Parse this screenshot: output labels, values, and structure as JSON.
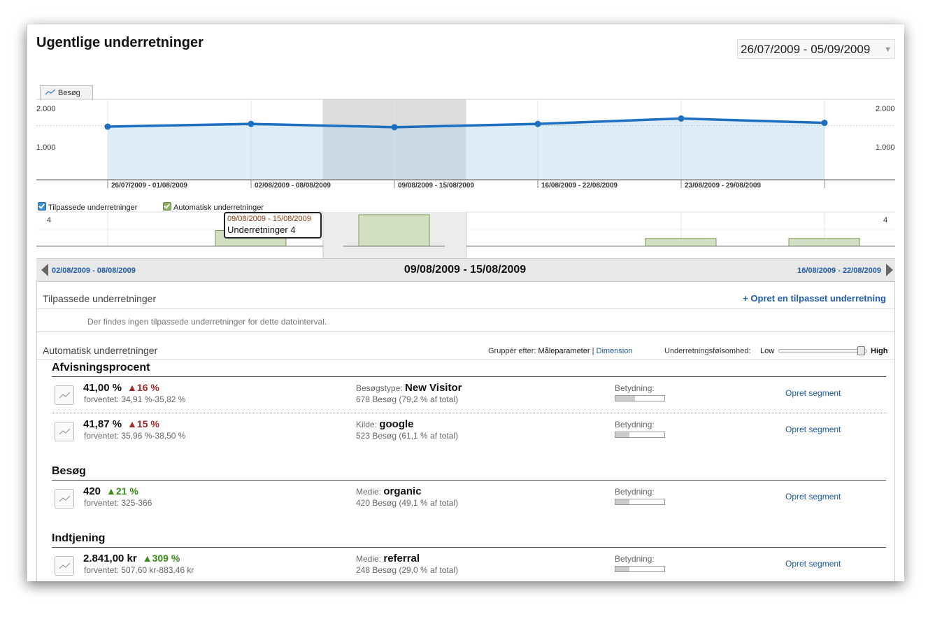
{
  "title": "Ugentlige underretninger",
  "date_range": "26/07/2009 - 05/09/2009",
  "chart_tab": "Besøg",
  "chart_data": {
    "type": "line",
    "series": [
      {
        "name": "Besøg",
        "values": [
          980,
          1030,
          970,
          1030,
          1130,
          1050
        ]
      }
    ],
    "ylim": [
      0,
      2000
    ],
    "y_ticks": [
      "2.000",
      "1.000"
    ],
    "x_labels": [
      "26/07/2009 - 01/08/2009",
      "02/08/2009 - 08/08/2009",
      "09/08/2009 - 15/08/2009",
      "16/08/2009 - 22/08/2009",
      "23/08/2009 - 29/08/2009"
    ],
    "highlighted_week": "09/08/2009 - 15/08/2009",
    "grid": true
  },
  "legend": {
    "custom": "Tilpassede underretninger",
    "auto": "Automatisk underretninger"
  },
  "alert_chart": {
    "y_max_label": "4",
    "values": [
      0,
      2,
      4,
      0,
      1,
      1
    ]
  },
  "tooltip": {
    "date": "09/08/2009 - 15/08/2009",
    "label": "Underretninger 4"
  },
  "nav": {
    "prev": "02/08/2009 - 08/08/2009",
    "current": "09/08/2009 - 15/08/2009",
    "next": "16/08/2009 - 22/08/2009"
  },
  "custom_section": {
    "heading": "Tilpassede underretninger",
    "create_link": "+ Opret en tilpasset underretning",
    "empty_text": "Der findes ingen tilpassede underretninger for dette datointerval."
  },
  "auto_section": {
    "heading": "Automatisk underretninger",
    "group_label": "Gruppér efter:",
    "group_metric": "Måleparameter",
    "group_sep": "|",
    "group_dimension": "Dimension",
    "sensitivity_label": "Underretningsfølsomhed:",
    "low": "Low",
    "high": "High",
    "sensitivity_level": 0.95
  },
  "groups": [
    {
      "name": "Afvisningsprocent",
      "alerts": [
        {
          "value": "41,00 %",
          "change": "16 %",
          "dir": "red",
          "expected": "forventet: 34,91 %-35,82 %",
          "dim_label": "Besøgstype:",
          "dim_value": "New Visitor",
          "dim_sub": "678 Besøg (79,2 % af total)",
          "importance_label": "Betydning:",
          "importance": 0.4,
          "action": "Opret segment"
        },
        {
          "value": "41,87 %",
          "change": "15 %",
          "dir": "red",
          "expected": "forventet: 35,96 %-38,50 %",
          "dim_label": "Kilde:",
          "dim_value": "google",
          "dim_sub": "523 Besøg (61,1 % af total)",
          "importance_label": "Betydning:",
          "importance": 0.28,
          "action": "Opret segment"
        }
      ]
    },
    {
      "name": "Besøg",
      "alerts": [
        {
          "value": "420",
          "change": "21 %",
          "dir": "green",
          "expected": "forventet: 325-366",
          "dim_label": "Medie:",
          "dim_value": "organic",
          "dim_sub": "420 Besøg (49,1 % af total)",
          "importance_label": "Betydning:",
          "importance": 0.28,
          "action": "Opret segment"
        }
      ]
    },
    {
      "name": "Indtjening",
      "alerts": [
        {
          "value": "2.841,00 kr",
          "change": "309 %",
          "dir": "green",
          "expected": "forventet: 507,60 kr-883,46 kr",
          "dim_label": "Medie:",
          "dim_value": "referral",
          "dim_sub": "248 Besøg (29,0 % af total)",
          "importance_label": "Betydning:",
          "importance": 0.28,
          "action": "Opret segment"
        }
      ]
    }
  ]
}
